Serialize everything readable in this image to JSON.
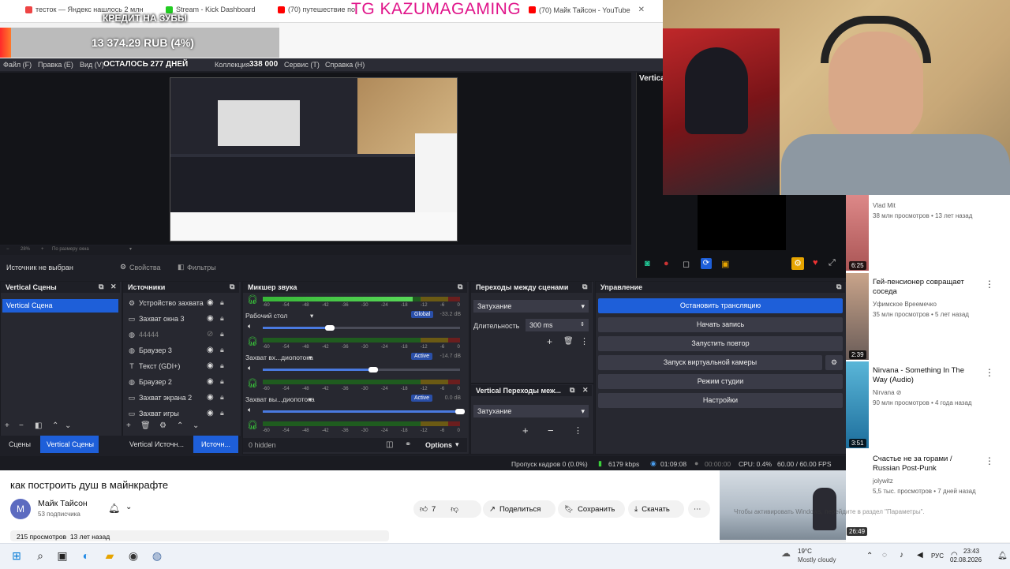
{
  "browser": {
    "tabs": [
      {
        "label": "тесток — Яндекс нашлось 2 млн",
        "color": "#e44"
      },
      {
        "label": "Stream - Kick Dashboard",
        "color": "#2c2"
      },
      {
        "label": "(70) путешествие по",
        "color": "#f00"
      },
      {
        "label": "(70) Майк Тайсон - YouTube",
        "color": "#f00"
      }
    ]
  },
  "overlay": {
    "brand": "TG KAZUMAGAMING",
    "donation_title": "КРЕДИТ НА ЗУБЫ",
    "donation_amount": "13 374.29 RUB (4%)",
    "donation_progress": 0.04,
    "days_left": "ОСТАЛОСЬ 277 ДНЕЙ",
    "number": "338 000"
  },
  "obs": {
    "menu": [
      "Файл (F)",
      "Правка (E)",
      "Вид (V)",
      "Коллекция",
      "Сервис (T)",
      "Справка (H)"
    ],
    "preview_zoom": "28%",
    "preview_fit": "По размеру окна",
    "vertical_title": "Vertica",
    "source_status": "Источник не выбран",
    "properties": "Свойства",
    "filters": "Фильтры",
    "scenes": {
      "title": "Vertical Сцены",
      "items": [
        "Vertical Сцена"
      ],
      "tab_scenes": "Сцены",
      "tab_vertical": "Vertical Сцены"
    },
    "sources": {
      "title": "Источники",
      "items": [
        {
          "icon": "⚙",
          "label": "Устройство захвата"
        },
        {
          "icon": "▭",
          "label": "Захват окна 3"
        },
        {
          "icon": "◍",
          "label": "44444"
        },
        {
          "icon": "◍",
          "label": "Браузер 3"
        },
        {
          "icon": "T",
          "label": "Текст (GDI+)"
        },
        {
          "icon": "◍",
          "label": "Браузер 2"
        },
        {
          "icon": "▭",
          "label": "Захват экрана 2"
        },
        {
          "icon": "▭",
          "label": "Захват игры"
        }
      ],
      "tab_vertical": "Vertical Источн...",
      "tab_sources": "Источн..."
    },
    "mixer": {
      "title": "Микшер звука",
      "scale": [
        "-60",
        "-54",
        "-48",
        "-42",
        "-36",
        "-30",
        "-24",
        "-18",
        "-12",
        "-6",
        "0"
      ],
      "channels": [
        {
          "name": "Рабочий стол",
          "tag": "Global",
          "db": "-33.2 dB",
          "volume": 0.34,
          "level": 0.76
        },
        {
          "name": "Захват вх...диопотока",
          "tag": "Active",
          "db": "-14.7 dB",
          "volume": 0.56,
          "level": 0.0
        },
        {
          "name": "Захват вы...диопотока",
          "tag": "Active",
          "db": "0.0 dB",
          "volume": 1.0,
          "level": 0.0
        }
      ],
      "hidden": "0 hidden",
      "options": "Options"
    },
    "transitions": {
      "title": "Переходы между сценами",
      "type": "Затухание",
      "duration_label": "Длительность",
      "duration": "300 ms"
    },
    "vertical_transitions": {
      "title": "Vertical Переходы меж...",
      "type": "Затухание"
    },
    "controls": {
      "title": "Управление",
      "buttons": [
        "Остановить трансляцию",
        "Начать запись",
        "Запустить повтор",
        "Запуск виртуальной камеры",
        "Режим студии",
        "Настройки"
      ]
    },
    "status": {
      "dropped": "Пропуск кадров 0 (0.0%)",
      "bitrate": "6179 kbps",
      "live_time": "01:09:08",
      "rec_time": "00:00:00",
      "cpu": "CPU: 0.4%",
      "fps": "60.00 / 60.00 FPS"
    },
    "vertical_badge": "6:25"
  },
  "youtube": {
    "video_title": "как построить душ в майнкрафте",
    "channel": "Майк Тайсон",
    "avatar_letter": "M",
    "subscribers": "53 подписчика",
    "likes": "7",
    "share": "Поделиться",
    "save": "Сохранить",
    "download": "Скачать",
    "views_date": "215 просмотров  13 лет назад",
    "side": [
      {
        "title": "",
        "channel": "Vlad Mit",
        "meta": "38 млн просмотров • 13 лет назад",
        "duration": "6:25"
      },
      {
        "title": "Гей-пенсионер совращает соседа",
        "channel": "Уфимское Вреемечко",
        "meta": "35 млн просмотров • 5 лет назад",
        "duration": "2:39"
      },
      {
        "title": "Nirvana - Something In The Way (Audio)",
        "channel": "Nirvana ⊘",
        "meta": "90 млн просмотров • 4 года назад",
        "duration": "3:51"
      },
      {
        "title": "Счастье не за горами / Russian Post-Punk",
        "channel": "jolywitz",
        "meta": "5,5 тыс. просмотров • 7 дней назад",
        "duration": "26:49"
      }
    ],
    "activate_windows": "Чтобы активировать Windows, перейдите в раздел \"Параметры\"."
  },
  "taskbar": {
    "weather_temp": "19°C",
    "weather_desc": "Mostly cloudy",
    "lang": "РУС",
    "time": "23:43",
    "date": "02.08.2026"
  }
}
